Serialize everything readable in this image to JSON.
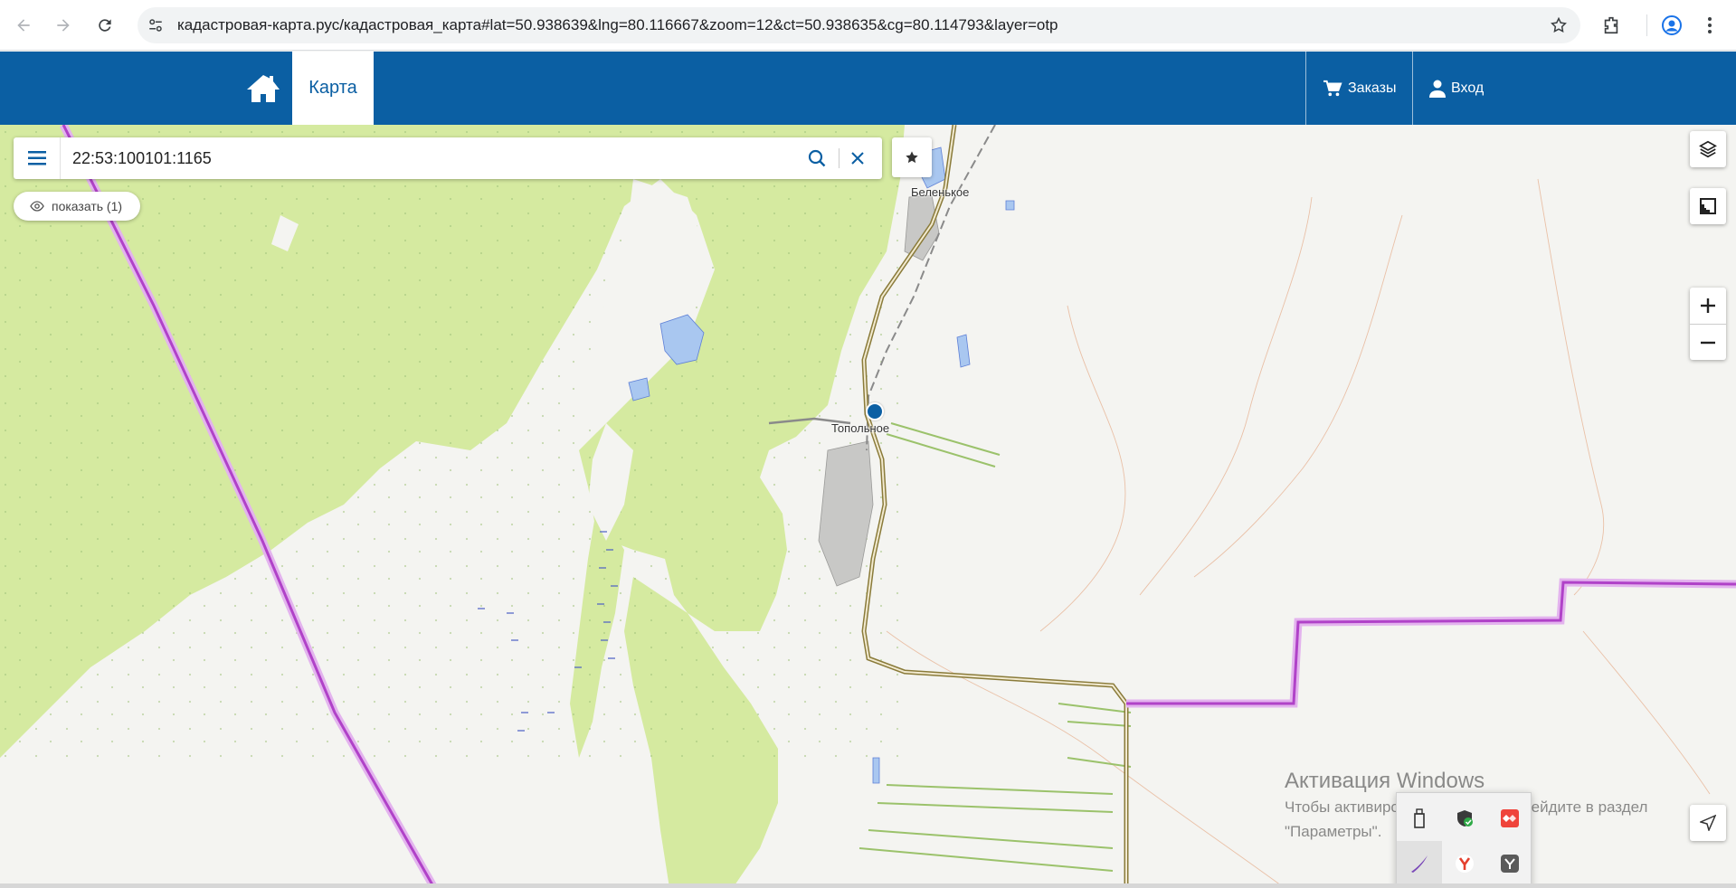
{
  "browser": {
    "url": "кадастровая-карта.рус/кадастровая_карта#lat=50.938639&lng=80.116667&zoom=12&ct=50.938635&cg=80.114793&layer=otp",
    "icons": [
      "back-icon",
      "forward-icon",
      "reload-icon",
      "site-info-icon",
      "bookmark-star-icon",
      "extensions-icon",
      "profile-icon",
      "more-icon"
    ]
  },
  "header": {
    "tab_label": "Карта",
    "orders_label": "Заказы",
    "login_label": "Вход",
    "brand_color": "#0b5fa3"
  },
  "search": {
    "query": "22:53:100101:1165",
    "show_label": "показать (1)"
  },
  "map": {
    "places": [
      "Беленькое",
      "Топольное"
    ],
    "colors": {
      "forest": "#d5eaa0",
      "background": "#f4f4f1",
      "boundary": "#b042c8",
      "road": "#8a7b3a",
      "water": "#a9c7f0"
    },
    "controls": [
      "layers-icon",
      "ruler-icon",
      "zoom-in",
      "zoom-out",
      "locate-icon"
    ]
  },
  "windows_activation": {
    "title": "Активация Windows",
    "line1": "Чтобы активировать Windows, перейдите в раздел",
    "line2": "\"Параметры\"."
  },
  "tray_icons": [
    "usb-icon",
    "security-shield-icon",
    "anydesk-icon",
    "pen-icon",
    "yandex-icon",
    "yandex-disk-icon"
  ]
}
